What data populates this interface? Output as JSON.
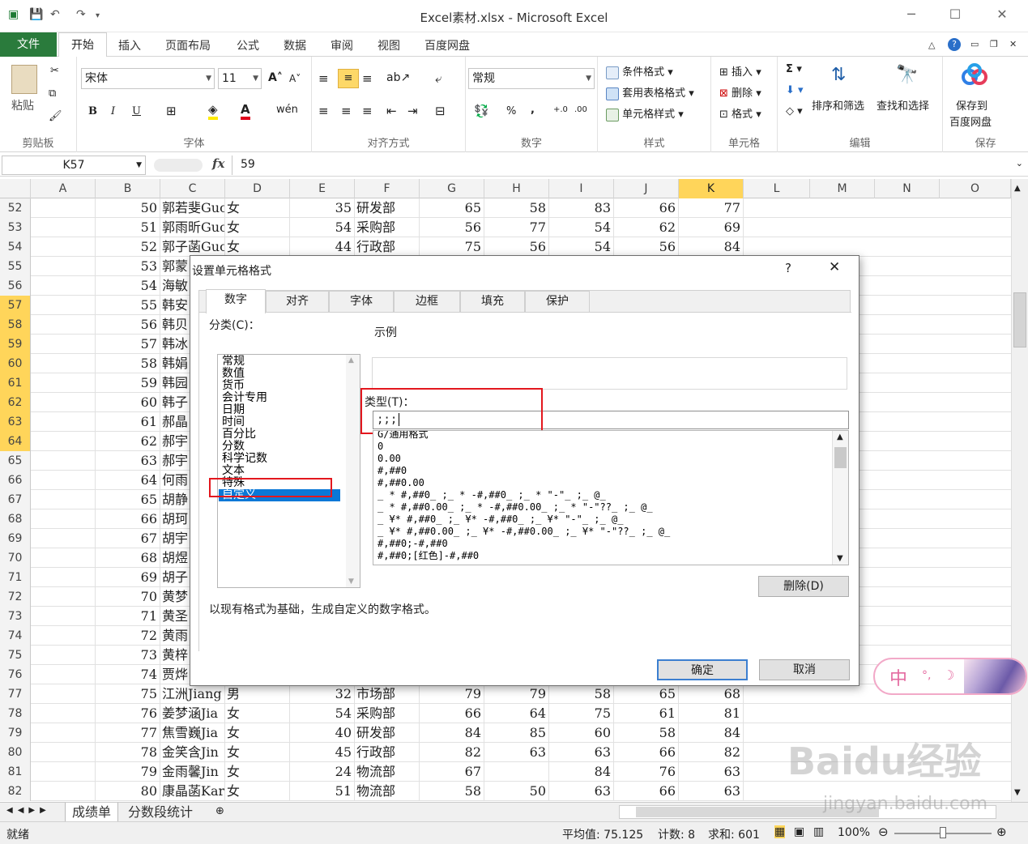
{
  "window": {
    "title": "Excel素材.xlsx  -  Microsoft Excel"
  },
  "tabs": [
    "文件",
    "开始",
    "插入",
    "页面布局",
    "公式",
    "数据",
    "审阅",
    "视图",
    "百度网盘"
  ],
  "ribbon": {
    "clipboard": {
      "paste": "粘贴",
      "label": "剪贴板"
    },
    "font": {
      "name": "宋体",
      "size": "11",
      "bold": "B",
      "italic": "I",
      "underline": "U",
      "label": "字体"
    },
    "align": {
      "label": "对齐方式"
    },
    "number": {
      "format": "常规",
      "percent": "%",
      "comma": ",",
      "label": "数字"
    },
    "styles": {
      "cond": "条件格式",
      "table": "套用表格格式",
      "cell": "单元格样式",
      "label": "样式"
    },
    "cells": {
      "insert": "插入",
      "delete": "删除",
      "format": "格式",
      "label": "单元格"
    },
    "edit": {
      "sort": "排序和筛选",
      "find": "查找和选择",
      "label": "编辑"
    },
    "save": {
      "btn1": "保存到",
      "btn2": "百度网盘",
      "label": "保存"
    }
  },
  "formula": {
    "namebox": "K57",
    "fx": "fx",
    "value": "59"
  },
  "columns": [
    "A",
    "B",
    "C",
    "D",
    "E",
    "F",
    "G",
    "H",
    "I",
    "J",
    "K",
    "L",
    "M",
    "N",
    "O"
  ],
  "rows": [
    {
      "n": "52",
      "b": "50",
      "c": "郭若斐Guo",
      "d": "女",
      "e": "35",
      "f": "研发部",
      "g": "65",
      "h": "58",
      "i": "83",
      "j": "66",
      "k": "77"
    },
    {
      "n": "53",
      "b": "51",
      "c": "郭雨昕Guo",
      "d": "女",
      "e": "54",
      "f": "采购部",
      "g": "56",
      "h": "77",
      "i": "54",
      "j": "62",
      "k": "69"
    },
    {
      "n": "54",
      "b": "52",
      "c": "郭子菡Guo",
      "d": "女",
      "e": "44",
      "f": "行政部",
      "g": "75",
      "h": "56",
      "i": "54",
      "j": "56",
      "k": "84"
    },
    {
      "n": "55",
      "b": "53",
      "c": "郭蒙",
      "d": "",
      "e": "",
      "f": "",
      "g": "",
      "h": "",
      "i": "",
      "j": "",
      "k": ""
    },
    {
      "n": "56",
      "b": "54",
      "c": "海敏",
      "d": "",
      "e": "",
      "f": "",
      "g": "",
      "h": "",
      "i": "",
      "j": "",
      "k": ""
    },
    {
      "n": "57",
      "b": "55",
      "c": "韩安",
      "d": "",
      "e": "",
      "f": "",
      "g": "",
      "h": "",
      "i": "",
      "j": "",
      "k": ""
    },
    {
      "n": "58",
      "b": "56",
      "c": "韩贝",
      "d": "",
      "e": "",
      "f": "",
      "g": "",
      "h": "",
      "i": "",
      "j": "",
      "k": ""
    },
    {
      "n": "59",
      "b": "57",
      "c": "韩冰",
      "d": "",
      "e": "",
      "f": "",
      "g": "",
      "h": "",
      "i": "",
      "j": "",
      "k": ""
    },
    {
      "n": "60",
      "b": "58",
      "c": "韩娟",
      "d": "",
      "e": "",
      "f": "",
      "g": "",
      "h": "",
      "i": "",
      "j": "",
      "k": ""
    },
    {
      "n": "61",
      "b": "59",
      "c": "韩园",
      "d": "",
      "e": "",
      "f": "",
      "g": "",
      "h": "",
      "i": "",
      "j": "",
      "k": ""
    },
    {
      "n": "62",
      "b": "60",
      "c": "韩子",
      "d": "",
      "e": "",
      "f": "",
      "g": "",
      "h": "",
      "i": "",
      "j": "",
      "k": ""
    },
    {
      "n": "63",
      "b": "61",
      "c": "郝晶",
      "d": "",
      "e": "",
      "f": "",
      "g": "",
      "h": "",
      "i": "",
      "j": "",
      "k": ""
    },
    {
      "n": "64",
      "b": "62",
      "c": "郝宇",
      "d": "",
      "e": "",
      "f": "",
      "g": "",
      "h": "",
      "i": "",
      "j": "",
      "k": ""
    },
    {
      "n": "65",
      "b": "63",
      "c": "郝宇",
      "d": "",
      "e": "",
      "f": "",
      "g": "",
      "h": "",
      "i": "",
      "j": "",
      "k": ""
    },
    {
      "n": "66",
      "b": "64",
      "c": "何雨",
      "d": "",
      "e": "",
      "f": "",
      "g": "",
      "h": "",
      "i": "",
      "j": "",
      "k": ""
    },
    {
      "n": "67",
      "b": "65",
      "c": "胡静",
      "d": "",
      "e": "",
      "f": "",
      "g": "",
      "h": "",
      "i": "",
      "j": "",
      "k": ""
    },
    {
      "n": "68",
      "b": "66",
      "c": "胡珂",
      "d": "",
      "e": "",
      "f": "",
      "g": "",
      "h": "",
      "i": "",
      "j": "",
      "k": ""
    },
    {
      "n": "69",
      "b": "67",
      "c": "胡宇",
      "d": "",
      "e": "",
      "f": "",
      "g": "",
      "h": "",
      "i": "",
      "j": "",
      "k": ""
    },
    {
      "n": "70",
      "b": "68",
      "c": "胡煜",
      "d": "",
      "e": "",
      "f": "",
      "g": "",
      "h": "",
      "i": "",
      "j": "",
      "k": ""
    },
    {
      "n": "71",
      "b": "69",
      "c": "胡子",
      "d": "",
      "e": "",
      "f": "",
      "g": "",
      "h": "",
      "i": "",
      "j": "",
      "k": ""
    },
    {
      "n": "72",
      "b": "70",
      "c": "黄梦",
      "d": "",
      "e": "",
      "f": "",
      "g": "",
      "h": "",
      "i": "",
      "j": "",
      "k": ""
    },
    {
      "n": "73",
      "b": "71",
      "c": "黄圣",
      "d": "",
      "e": "",
      "f": "",
      "g": "",
      "h": "",
      "i": "",
      "j": "",
      "k": ""
    },
    {
      "n": "74",
      "b": "72",
      "c": "黄雨",
      "d": "",
      "e": "",
      "f": "",
      "g": "",
      "h": "",
      "i": "",
      "j": "",
      "k": ""
    },
    {
      "n": "75",
      "b": "73",
      "c": "黄梓",
      "d": "",
      "e": "",
      "f": "",
      "g": "",
      "h": "",
      "i": "",
      "j": "",
      "k": ""
    },
    {
      "n": "76",
      "b": "74",
      "c": "贾烨",
      "d": "",
      "e": "",
      "f": "",
      "g": "",
      "h": "",
      "i": "",
      "j": "",
      "k": ""
    },
    {
      "n": "77",
      "b": "75",
      "c": "江洲Jiang",
      "d": "男",
      "e": "32",
      "f": "市场部",
      "g": "79",
      "h": "79",
      "i": "58",
      "j": "65",
      "k": "68"
    },
    {
      "n": "78",
      "b": "76",
      "c": "姜梦涵Jia",
      "d": "女",
      "e": "54",
      "f": "采购部",
      "g": "66",
      "h": "64",
      "i": "75",
      "j": "61",
      "k": "81"
    },
    {
      "n": "79",
      "b": "77",
      "c": "焦雪巍Jia",
      "d": "女",
      "e": "40",
      "f": "研发部",
      "g": "84",
      "h": "85",
      "i": "60",
      "j": "58",
      "k": "84"
    },
    {
      "n": "80",
      "b": "78",
      "c": "金笑含Jin",
      "d": "女",
      "e": "45",
      "f": "行政部",
      "g": "82",
      "h": "63",
      "i": "63",
      "j": "66",
      "k": "82"
    },
    {
      "n": "81",
      "b": "79",
      "c": "金雨馨Jin",
      "d": "女",
      "e": "24",
      "f": "物流部",
      "g": "67",
      "h": "",
      "i": "84",
      "j": "76",
      "k": "63"
    },
    {
      "n": "82",
      "b": "80",
      "c": "康晶菡Kar",
      "d": "女",
      "e": "51",
      "f": "物流部",
      "g": "58",
      "h": "50",
      "i": "63",
      "j": "66",
      "k": "63"
    }
  ],
  "sheets": [
    "成绩单",
    "分数段统计"
  ],
  "status": {
    "ready": "就绪",
    "avg": "平均值: 75.125",
    "count": "计数: 8",
    "sum": "求和: 601",
    "zoom": "100%"
  },
  "dialog": {
    "title": "设置单元格格式",
    "help": "?",
    "tabs": [
      "数字",
      "对齐",
      "字体",
      "边框",
      "填充",
      "保护"
    ],
    "category_label": "分类(C)：",
    "categories": [
      "常规",
      "数值",
      "货币",
      "会计专用",
      "日期",
      "时间",
      "百分比",
      "分数",
      "科学记数",
      "文本",
      "特殊",
      "自定义"
    ],
    "sample_label": "示例",
    "type_label": "类型(T)：",
    "type_value": ";;;",
    "formats": [
      "G/通用格式",
      "0",
      "0.00",
      "#,##0",
      "#,##0.00",
      "_ * #,##0_ ;_ * -#,##0_ ;_ * \"-\"_ ;_ @_",
      "_ * #,##0.00_ ;_ * -#,##0.00_ ;_ * \"-\"??_ ;_ @_",
      "_ ¥* #,##0_ ;_ ¥* -#,##0_ ;_ ¥* \"-\"_ ;_ @_",
      "_ ¥* #,##0.00_ ;_ ¥* -#,##0.00_ ;_ ¥* \"-\"??_ ;_ @_",
      "#,##0;-#,##0",
      "#,##0;[红色]-#,##0"
    ],
    "delete_btn": "删除(D)",
    "description": "以现有格式为基础，生成自定义的数字格式。",
    "ok": "确定",
    "cancel": "取消"
  },
  "ime": {
    "mode": "中"
  },
  "watermark": {
    "brand": "Baidu经验",
    "url": "jingyan.baidu.com"
  }
}
